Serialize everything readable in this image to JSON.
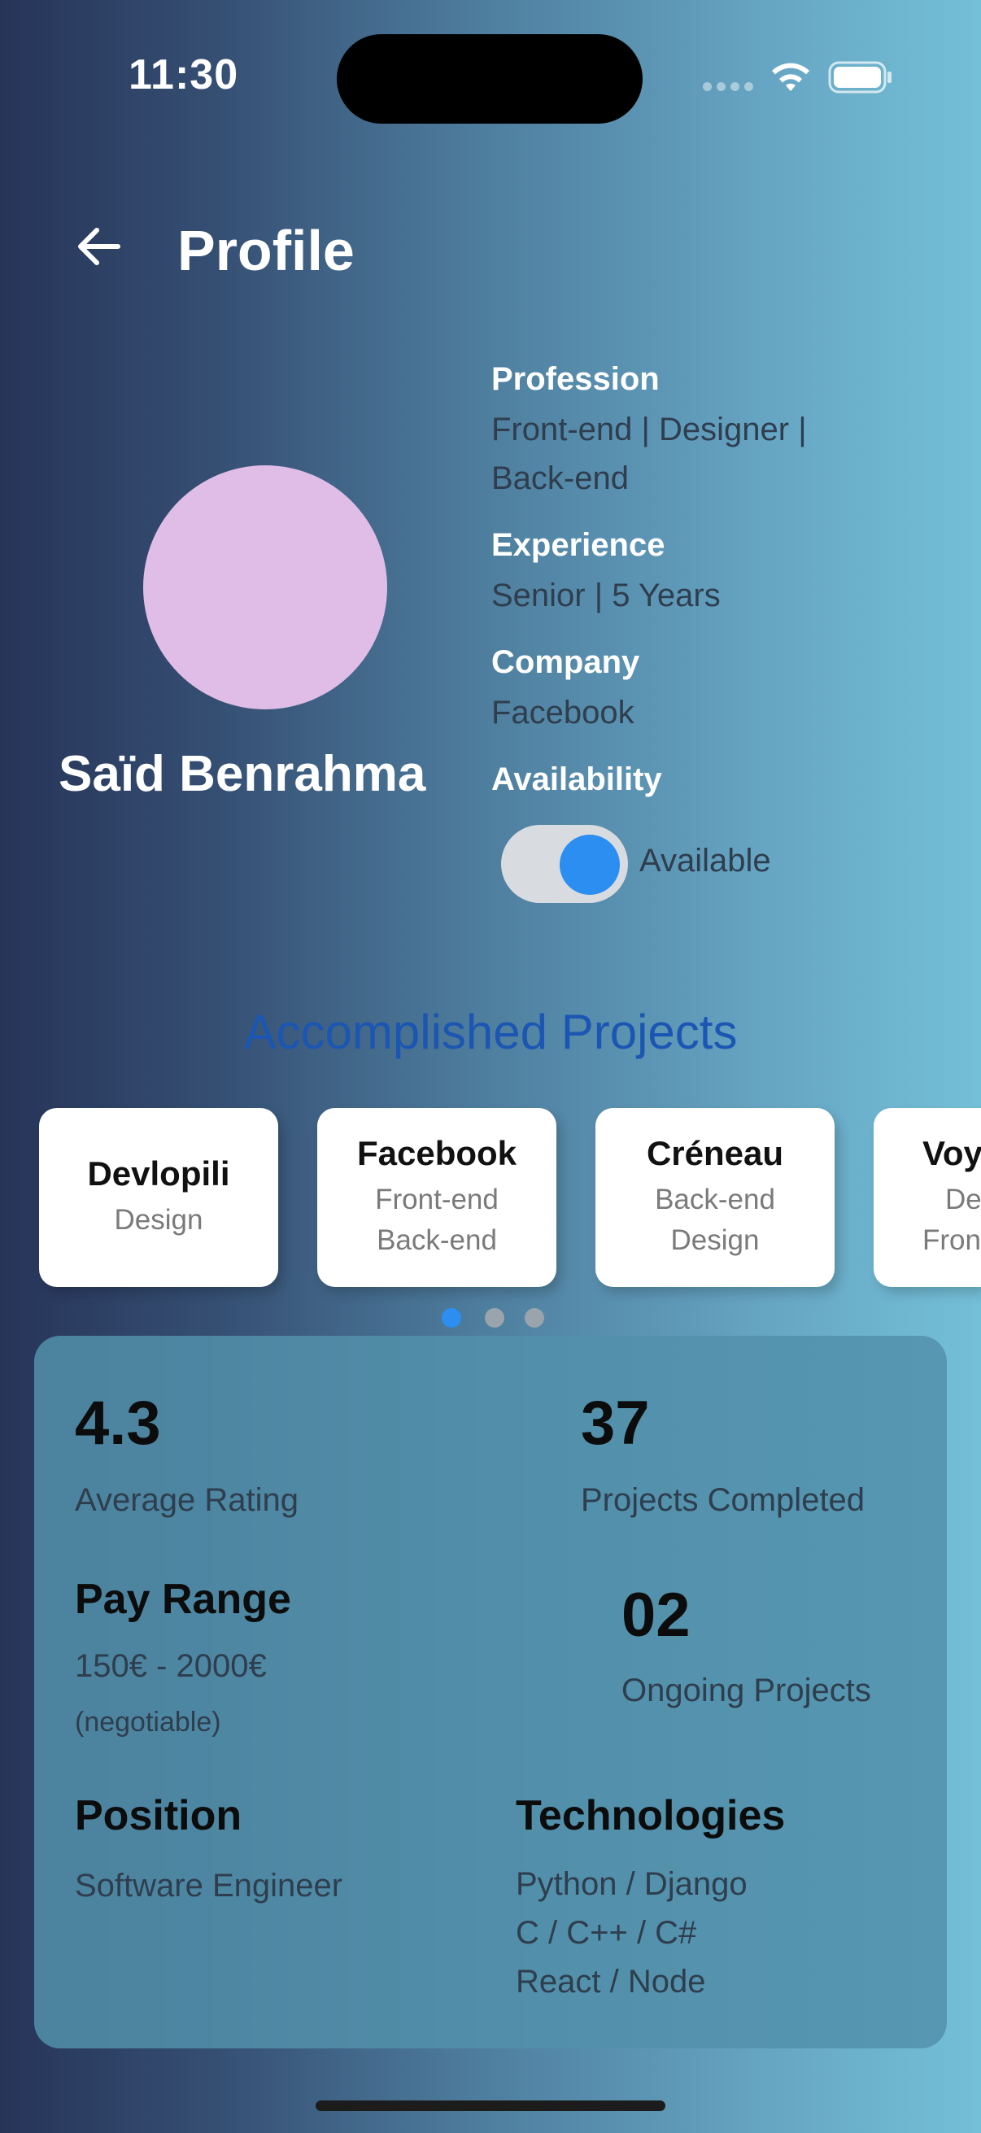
{
  "status_bar": {
    "time": "11:30"
  },
  "header": {
    "title": "Profile"
  },
  "profile": {
    "name": "Saïd Benrahma",
    "avatar_color": "#e0bde6",
    "profession_label": "Profession",
    "profession_lines": [
      "Front-end | Designer |",
      "Back-end"
    ],
    "experience_label": "Experience",
    "experience_value": "Senior | 5 Years",
    "company_label": "Company",
    "company_value": "Facebook",
    "availability_label": "Availability",
    "availability_state": "Available",
    "availability_on": true
  },
  "projects": {
    "title": "Accomplished Projects",
    "items": [
      {
        "title": "Devlopili",
        "lines": [
          "Design"
        ]
      },
      {
        "title": "Facebook",
        "lines": [
          "Front-end",
          "Back-end"
        ]
      },
      {
        "title": "Créneau",
        "lines": [
          "Back-end",
          "Design"
        ]
      },
      {
        "title": "Voy",
        "lines": [
          "De",
          "Fron"
        ]
      }
    ],
    "page_count": 3,
    "active_page": 1
  },
  "stats": {
    "rating_value": "4.3",
    "rating_label": "Average Rating",
    "completed_value": "37",
    "completed_label": "Projects Completed",
    "pay_label": "Pay Range",
    "pay_value": "150€ - 2000€",
    "pay_note": "(negotiable)",
    "ongoing_value": "02",
    "ongoing_label": "Ongoing Projects",
    "position_label": "Position",
    "position_value": "Software Engineer",
    "tech_label": "Technologies",
    "tech_lines": [
      "Python / Django",
      "C / C++ / C#",
      "React / Node"
    ]
  },
  "colors": {
    "accent": "#2b8ef0",
    "projects_title": "#1b56b3",
    "panel": "#5291aa"
  }
}
